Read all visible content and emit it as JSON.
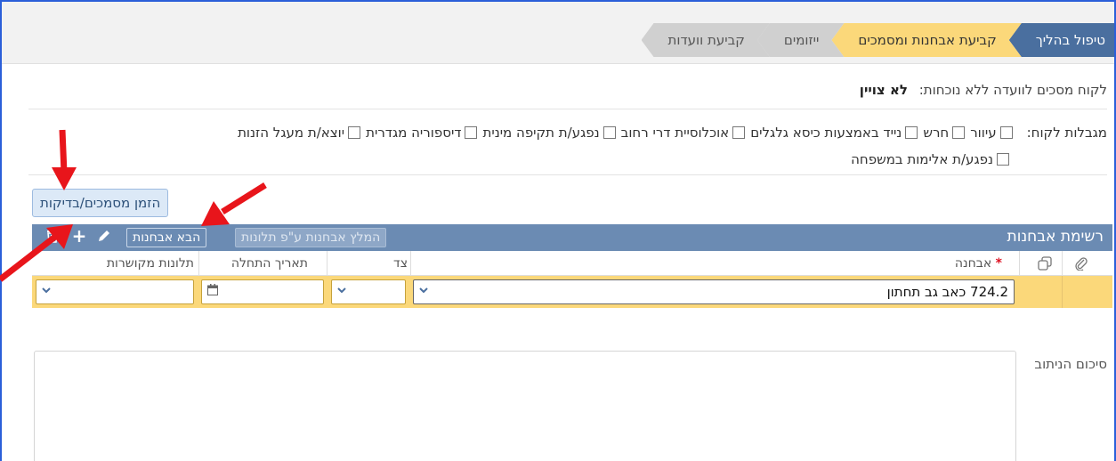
{
  "steps": [
    {
      "label": "טיפול בהליך"
    },
    {
      "label": "קביעת אבחנות ומסמכים"
    },
    {
      "label": "ייזומים"
    },
    {
      "label": "קביעת וועדות"
    }
  ],
  "client": {
    "label": "לקוח מסכים לוועדה ללא נוכחות:",
    "value": "לא צויין"
  },
  "limits": {
    "label": "מגבלות לקוח:",
    "items": [
      "עיוור",
      "חרש",
      "נייד באמצעות כיסא גלגלים",
      "אוכלוסיית דרי רחוב",
      "נפגע/ת תקיפה מינית",
      "דיספוריה מגדרית",
      "יוצא/ת מעגל הזנות",
      "נפגע/ת אלימות במשפחה"
    ]
  },
  "order_button": "הזמן מסמכים/בדיקות",
  "diagnosis_panel": {
    "title": "רשימת אבחנות",
    "recommend_button": "המלץ אבחנות ע\"פ תלונות",
    "fetch_button": "הבא אבחנות",
    "columns": {
      "diagnosis": "אבחנה",
      "required_mark": "*",
      "side": "צד",
      "start_date": "תאריך התחלה",
      "complaints": "תלונות מקושרות"
    },
    "row": {
      "diagnosis_value": "724.2 כאב גב תחתון"
    }
  },
  "summary_label": "סיכום הניתוב",
  "colors": {
    "step_active": "#4a6f9f",
    "step_current": "#fbd87a",
    "panel_header": "#6b8bb3",
    "arrow": "#e8151b"
  }
}
